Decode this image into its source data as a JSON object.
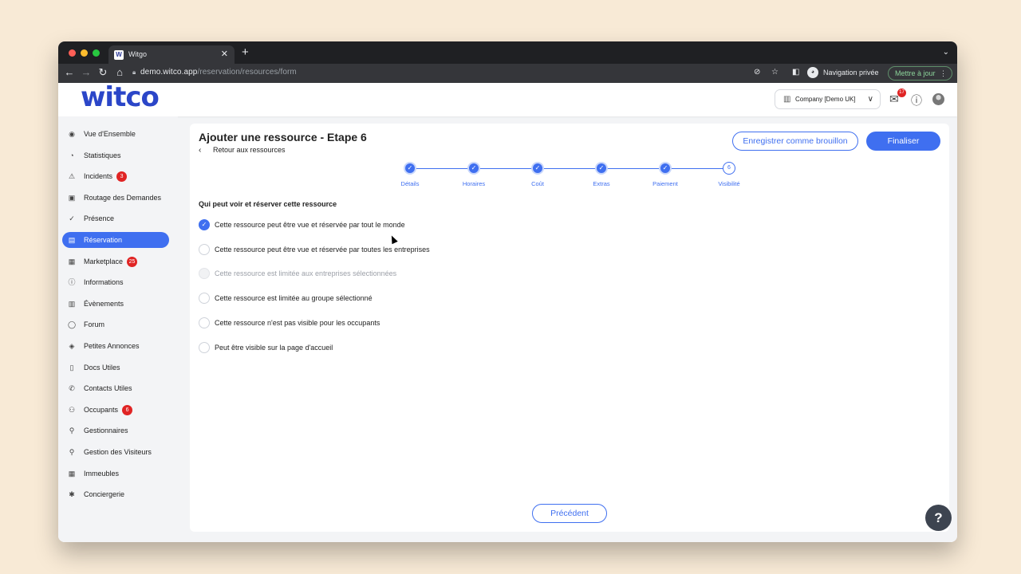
{
  "browser": {
    "tab_title": "Witgo",
    "favicon_text": "W",
    "url_host": "demo.witco.app",
    "url_path": "/reservation/resources/form",
    "incognito_label": "Navigation privée",
    "update_label": "Mettre à jour"
  },
  "header": {
    "logo": "witco",
    "company_select": "Company [Demo UK]",
    "mail_badge": "17"
  },
  "sidebar": {
    "items": [
      {
        "label": "Vue d'Ensemble",
        "icon": "eye-icon",
        "glyph": "◉"
      },
      {
        "label": "Statistiques",
        "icon": "pie-chart-icon",
        "glyph": "◔"
      },
      {
        "label": "Incidents",
        "icon": "warning-icon",
        "glyph": "⚠",
        "badge": "3"
      },
      {
        "label": "Routage des Demandes",
        "icon": "routing-icon",
        "glyph": "▣"
      },
      {
        "label": "Présence",
        "icon": "check-circle-icon",
        "glyph": "✓"
      },
      {
        "label": "Réservation",
        "icon": "calendar-icon",
        "glyph": "▤",
        "active": true
      },
      {
        "label": "Marketplace",
        "icon": "store-icon",
        "glyph": "▦",
        "badge": "25"
      },
      {
        "label": "Informations",
        "icon": "info-icon",
        "glyph": "ⓘ"
      },
      {
        "label": "Évènements",
        "icon": "event-calendar-icon",
        "glyph": "▥"
      },
      {
        "label": "Forum",
        "icon": "chat-bubble-icon",
        "glyph": "◯"
      },
      {
        "label": "Petites Annonces",
        "icon": "tag-icon",
        "glyph": "◈"
      },
      {
        "label": "Docs Utiles",
        "icon": "document-icon",
        "glyph": "▯"
      },
      {
        "label": "Contacts Utiles",
        "icon": "phone-icon",
        "glyph": "✆"
      },
      {
        "label": "Occupants",
        "icon": "users-icon",
        "glyph": "⚇",
        "badge": "6"
      },
      {
        "label": "Gestionnaires",
        "icon": "user-icon",
        "glyph": "⚲"
      },
      {
        "label": "Gestion des Visiteurs",
        "icon": "visitor-icon",
        "glyph": "⚲"
      },
      {
        "label": "Immeubles",
        "icon": "building-icon",
        "glyph": "▦"
      },
      {
        "label": "Conciergerie",
        "icon": "concierge-icon",
        "glyph": "✱"
      }
    ]
  },
  "page": {
    "title": "Ajouter une ressource - Etape 6",
    "back_link": "Retour aux ressources",
    "draft_button": "Enregistrer comme brouillon",
    "finalize_button": "Finaliser",
    "previous_button": "Précédent",
    "help_button": "?"
  },
  "stepper": {
    "steps": [
      {
        "label": "Détails",
        "done": true
      },
      {
        "label": "Horaires",
        "done": true
      },
      {
        "label": "Coût",
        "done": true
      },
      {
        "label": "Extras",
        "done": true
      },
      {
        "label": "Paiement",
        "done": true
      },
      {
        "label": "Visibilité",
        "done": false,
        "number": "6"
      }
    ]
  },
  "visibility": {
    "question": "Qui peut voir et réserver cette ressource",
    "options": [
      {
        "label": "Cette ressource peut être vue et réservée par tout le monde",
        "selected": true
      },
      {
        "label": "Cette ressource peut être vue et réservée par toutes les entreprises"
      },
      {
        "label": "Cette ressource est limitée aux entreprises sélectionnées",
        "disabled": true
      },
      {
        "label": "Cette ressource est limitée au groupe sélectionné"
      },
      {
        "label": "Cette ressource n'est pas visible pour les occupants"
      },
      {
        "label": "Peut être visible sur la page d'accueil"
      }
    ]
  },
  "colors": {
    "accent": "#3f6ff0",
    "badge": "#e02424",
    "page_bg": "#f8ead6"
  }
}
